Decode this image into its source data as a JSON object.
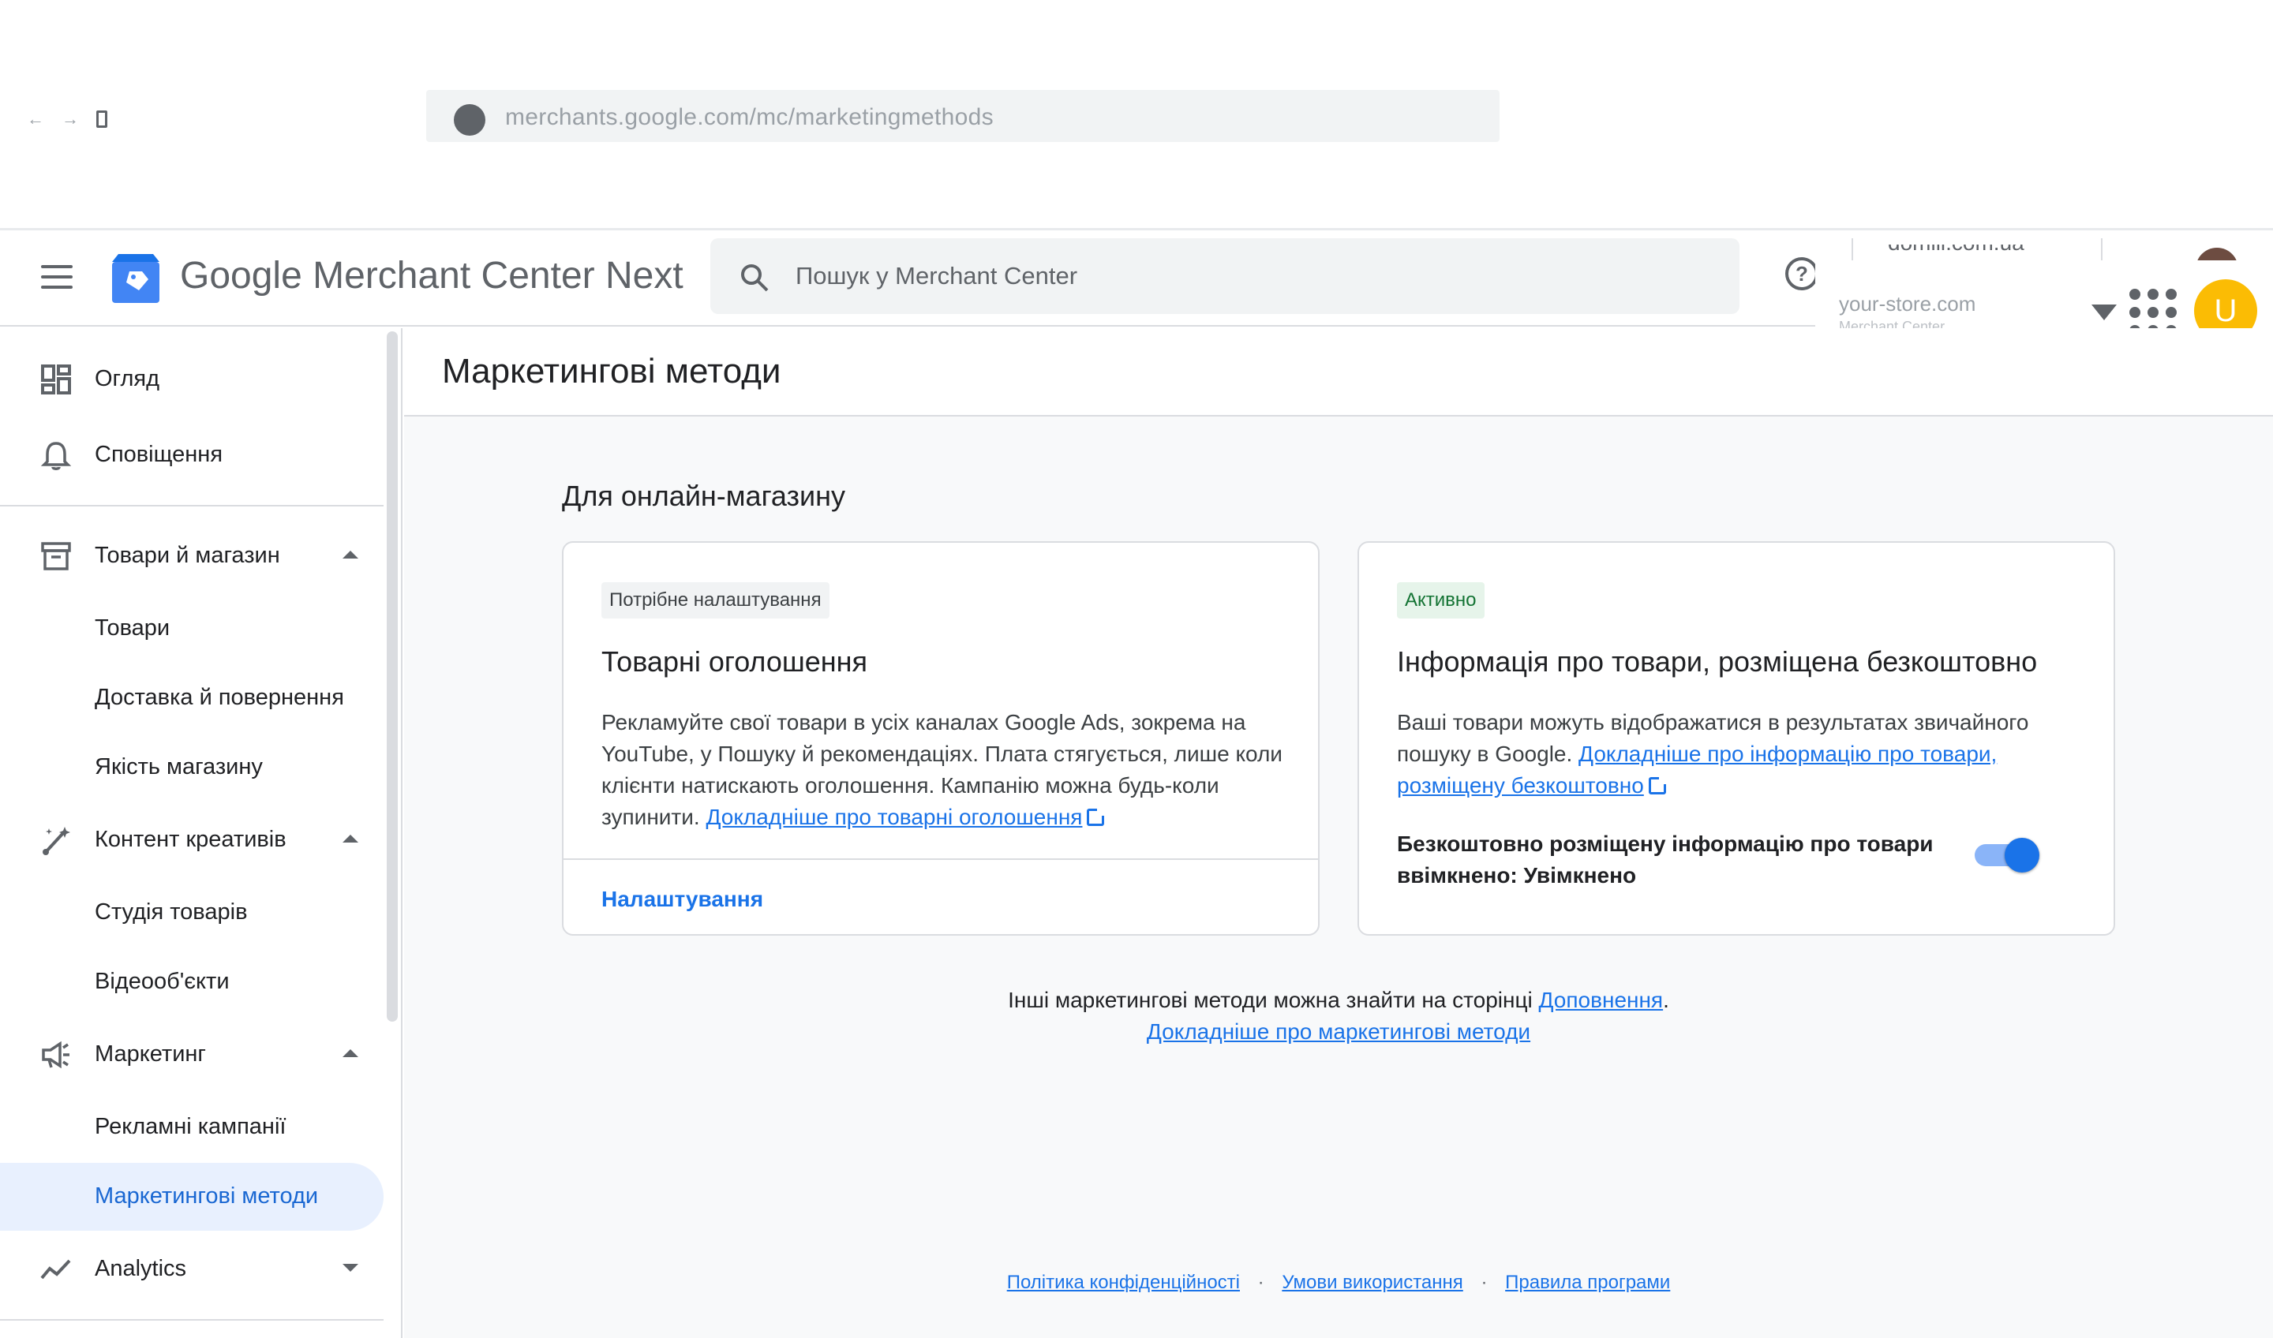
{
  "browser": {
    "url": "merchants.google.com/mc/marketingmethods",
    "nav_back": "←",
    "nav_forward": "→"
  },
  "header": {
    "brand_google": "Google",
    "brand_product": "Merchant Center Next",
    "search_placeholder": "Пошук у Merchant Center",
    "help_glyph": "?",
    "account_clipped": "domili.com.ua",
    "store_name": "your-store.com",
    "store_sub": "Merchant Center",
    "avatar_letter": "U"
  },
  "sidebar": {
    "items": [
      {
        "label": "Огляд"
      },
      {
        "label": "Сповіщення"
      },
      {
        "label": "Товари й магазин"
      },
      {
        "label": "Товари"
      },
      {
        "label": "Доставка й повернення"
      },
      {
        "label": "Якість магазину"
      },
      {
        "label": "Контент креативів"
      },
      {
        "label": "Студія товарів"
      },
      {
        "label": "Відеооб'єкти"
      },
      {
        "label": "Маркетинг"
      },
      {
        "label": "Рекламні кампанії"
      },
      {
        "label": "Маркетингові методи"
      },
      {
        "label": "Analytics"
      }
    ],
    "active_color": "#1967d2"
  },
  "main": {
    "page_title": "Маркетингові методи",
    "section_title": "Для онлайн-магазину",
    "card_ads": {
      "badge": "Потрібне налаштування",
      "title": "Товарні оголошення",
      "body": "Рекламуйте свої товари в усіх каналах Google Ads, зокрема на YouTube, у Пошуку й рекомендаціях. Плата стягується, лише коли клієнти натискають оголошення. Кампанію можна будь-коли зупинити.",
      "link": "Докладніше про товарні оголошення",
      "action": "Налаштування"
    },
    "card_free": {
      "badge": "Активно",
      "title": "Інформація про товари, розміщена безкоштовно",
      "body": "Ваші товари можуть відображатися в результатах звичайного пошуку в Google.",
      "link": "Докладніше про інформацію про товари, розміщену безкоштовно",
      "toggle_label": "Безкоштовно розміщену інформацію про товари ввімкнено: Увімкнено",
      "toggle_on": true
    },
    "other_text": "Інші маркетингові методи можна знайти на сторінці",
    "other_link": "Доповнення",
    "other_period": ".",
    "learn_more_link": "Докладніше про маркетингові методи"
  },
  "footer": {
    "privacy": "Політика конфіденційності",
    "terms": "Умови використання",
    "program": "Правила програми",
    "separator": "·"
  },
  "colors": {
    "accent": "#1a73e8",
    "active_bg": "#e8f0fe",
    "badge_green_bg": "#e6f4ea",
    "avatar": "#fbbc04"
  }
}
